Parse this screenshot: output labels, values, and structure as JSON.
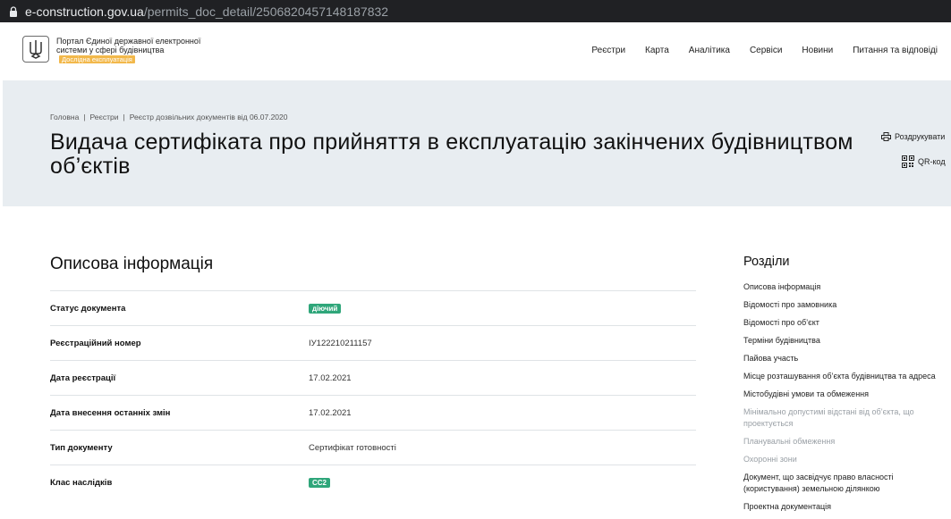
{
  "browser": {
    "url_host": "e-construction.gov.ua",
    "url_path": "/permits_doc_detail/2506820457148187832"
  },
  "header": {
    "portal_name": "Портал Єдиної державної електронної системи у сфері будівництва",
    "beta_label": "Дослідна експлуатація",
    "nav": [
      "Реєстри",
      "Карта",
      "Аналітика",
      "Сервіси",
      "Новини",
      "Питання та відповіді"
    ]
  },
  "hero": {
    "breadcrumb": [
      "Головна",
      "Реєстри",
      "Реєстр дозвільних документів від 06.07.2020"
    ],
    "title": "Видача сертифіката про прийняття в експлуатацію закінчених будівництвом об’єктів",
    "print_label": "Роздрукувати",
    "qr_label": "QR-код"
  },
  "main": {
    "section_title": "Описова інформація",
    "rows": [
      {
        "key": "Статус документа",
        "value": "діючий",
        "badge": true
      },
      {
        "key": "Реєстраційний номер",
        "value": "ІУ122210211157",
        "badge": false
      },
      {
        "key": "Дата реєстрації",
        "value": "17.02.2021",
        "badge": false
      },
      {
        "key": "Дата внесення останніх змін",
        "value": "17.02.2021",
        "badge": false
      },
      {
        "key": "Тип документу",
        "value": "Сертифікат готовності",
        "badge": false
      },
      {
        "key": "Клас наслідків",
        "value": "СС2",
        "badge": true
      }
    ]
  },
  "sidebar": {
    "title": "Розділи",
    "items": [
      {
        "label": "Описова інформація",
        "muted": false
      },
      {
        "label": "Відомості про замовника",
        "muted": false
      },
      {
        "label": "Відомості про об’єкт",
        "muted": false
      },
      {
        "label": "Терміни будівництва",
        "muted": false
      },
      {
        "label": "Пайова участь",
        "muted": false
      },
      {
        "label": "Місце розташування об’єкта будівництва та адреса",
        "muted": false
      },
      {
        "label": "Містобудівні умови та обмеження",
        "muted": false
      },
      {
        "label": "Мінімально допустимі відстані від об’єкта, що проектується",
        "muted": true
      },
      {
        "label": "Планувальні обмеження",
        "muted": true
      },
      {
        "label": "Охоронні зони",
        "muted": true
      },
      {
        "label": "Документ, що засвідчує право власності (користування) земельною ділянкою",
        "muted": false
      },
      {
        "label": "Проектна документація",
        "muted": false
      }
    ]
  },
  "colors": {
    "accent_green": "#2fa67a",
    "beta_orange": "#f2b84b",
    "hero_bg": "#e8edf1"
  }
}
